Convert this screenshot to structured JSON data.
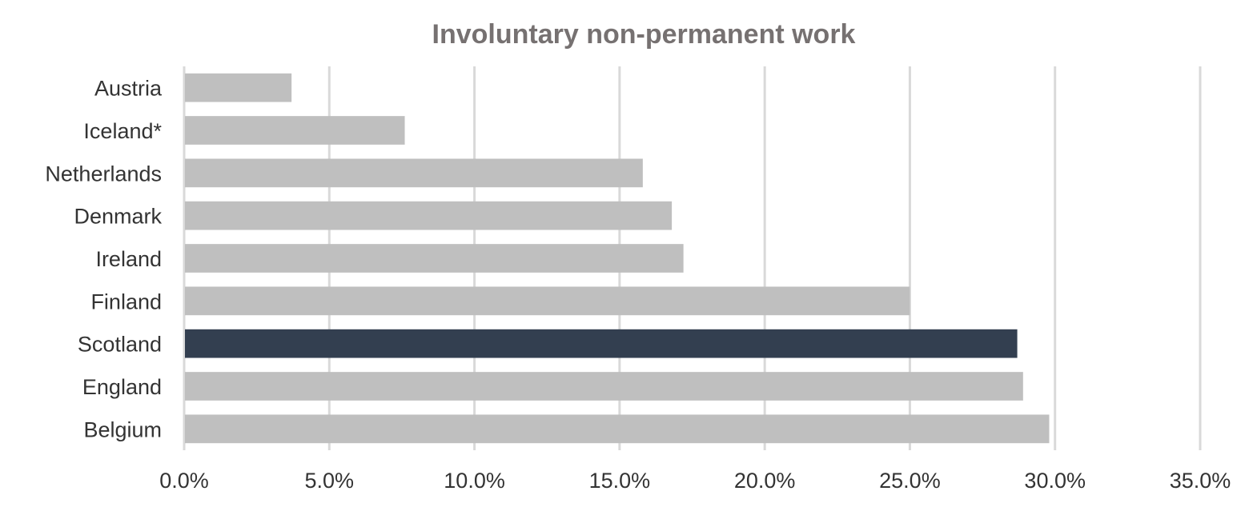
{
  "chart_data": {
    "type": "bar",
    "orientation": "horizontal",
    "title": "Involuntary non-permanent work",
    "xlabel": "",
    "ylabel": "",
    "categories": [
      "Austria",
      "Iceland*",
      "Netherlands",
      "Denmark",
      "Ireland",
      "Finland",
      "Scotland",
      "England",
      "Belgium"
    ],
    "values": [
      3.7,
      7.6,
      15.8,
      16.8,
      17.2,
      25.0,
      28.7,
      28.9,
      29.8
    ],
    "value_unit": "%",
    "highlight": "Scotland",
    "xlim": [
      0,
      35
    ],
    "x_ticks": [
      0,
      5,
      10,
      15,
      20,
      25,
      30,
      35
    ],
    "x_tick_labels": [
      "0.0%",
      "5.0%",
      "10.0%",
      "15.0%",
      "20.0%",
      "25.0%",
      "30.0%",
      "35.0%"
    ],
    "grid": "vertical",
    "legend": "none",
    "colors": {
      "bar": "#bfbfbf",
      "highlight_bar": "#333f50",
      "grid": "#d9d9d9",
      "title": "#767171",
      "labels": "#333333"
    }
  }
}
